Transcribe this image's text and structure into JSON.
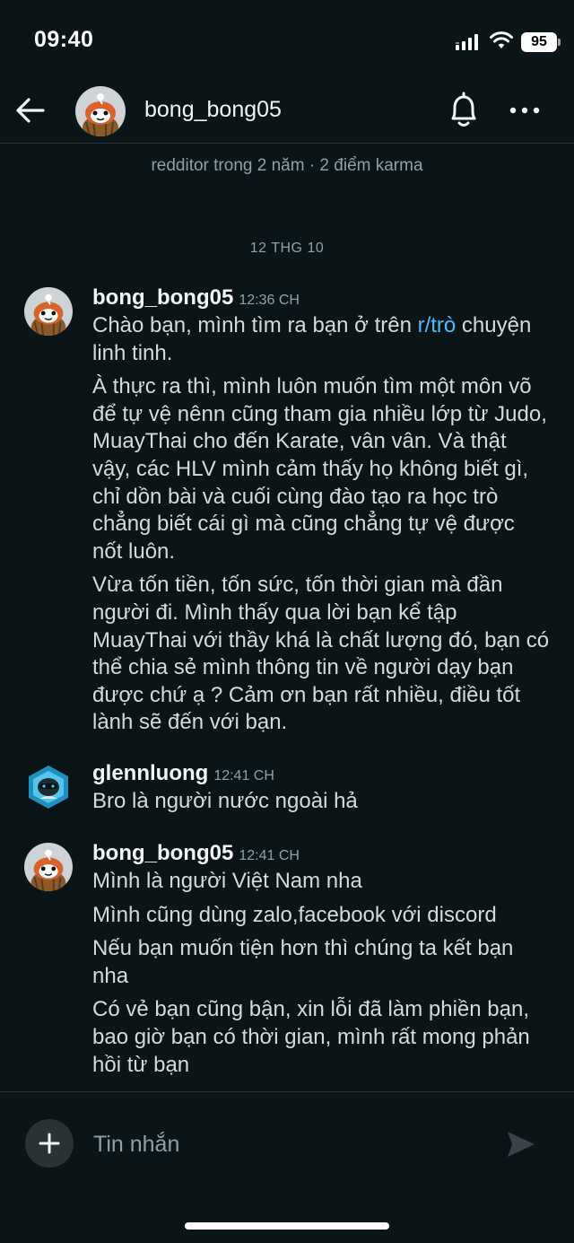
{
  "status_bar": {
    "time": "09:40",
    "battery": "95"
  },
  "header": {
    "username": "bong_bong05"
  },
  "account_info": "redditor trong 2 năm · 2 điểm karma",
  "date_divider": "12 THG 10",
  "messages": [
    {
      "author": "bong_bong05",
      "time": "12:36 CH",
      "paragraphs": [
        {
          "before": "Chào bạn, mình tìm ra bạn ở trên ",
          "link": "r/trò",
          "after": " chuyện linh tinh."
        },
        "À thực ra thì, mình luôn muốn tìm một môn võ để tự vệ nênn cũng tham gia nhiều lớp từ Judo, MuayThai cho đến Karate, vân vân. Và thật vậy, các HLV mình cảm thấy họ không biết gì, chỉ dồn bài và cuối cùng đào tạo ra học trò chẳng biết cái gì mà cũng chẳng tự vệ được nốt luôn.",
        "Vừa tốn tiền, tốn sức, tốn thời gian mà đần người đi. Mình thấy qua lời bạn kể tập MuayThai với thầy khá là chất lượng đó, bạn có thể chia sẻ mình thông tin về người dạy bạn được chứ ạ ? Cảm ơn bạn rất nhiều, điều tốt lành sẽ đến với bạn."
      ]
    },
    {
      "author": "glennluong",
      "time": "12:41 CH",
      "paragraphs": [
        "Bro là người nước ngoài hả"
      ]
    },
    {
      "author": "bong_bong05",
      "time": "12:41 CH",
      "paragraphs": [
        "Mình là người Việt Nam nha",
        "Mình cũng dùng zalo,facebook với discord",
        "Nếu bạn muốn tiện hơn thì chúng ta kết bạn nha",
        "Có vẻ bạn cũng bận, xin lỗi đã làm phiền bạn, bao giờ bạn có thời gian, mình rất mong phản hồi từ bạn"
      ]
    }
  ],
  "composer": {
    "placeholder": "Tin nhắn"
  },
  "icons": {
    "back": "back-arrow-icon",
    "bell": "bell-icon",
    "more": "more-dots-icon",
    "plus": "plus-icon",
    "send": "send-icon"
  },
  "colors": {
    "background": "#0b1416",
    "link": "#4fbcff",
    "muted": "#8ba2ad"
  }
}
